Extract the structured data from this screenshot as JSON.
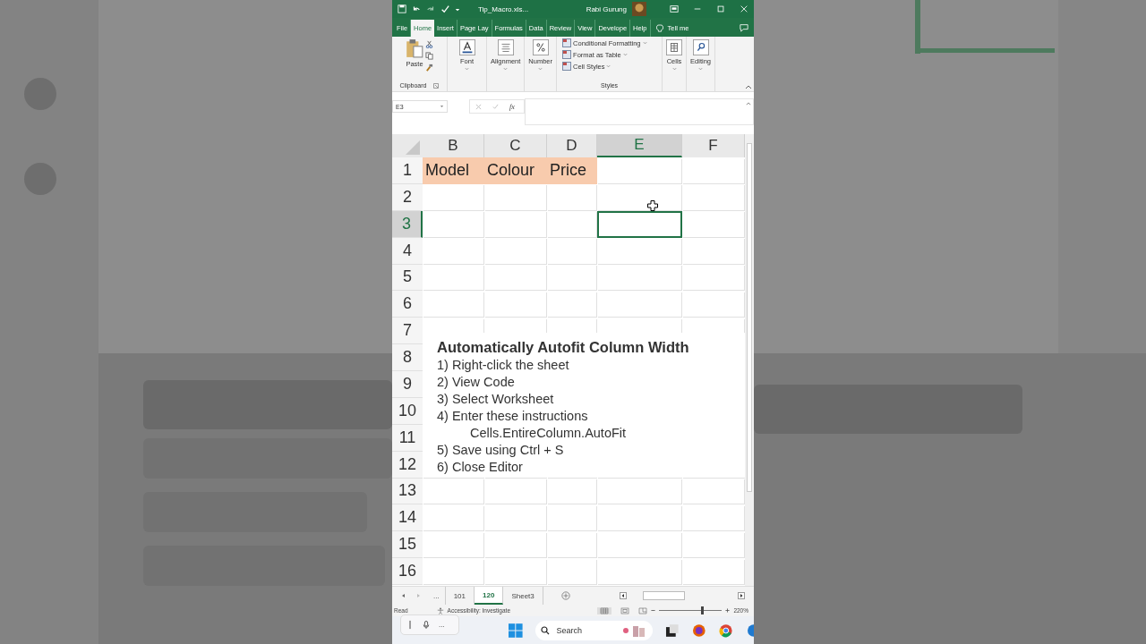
{
  "title_bar": {
    "filename": "Tip_Macro.xls...",
    "user": "Rabi Gurung"
  },
  "ribbon_tabs": [
    {
      "label": "File",
      "selected": false
    },
    {
      "label": "Home",
      "selected": true
    },
    {
      "label": "Insert",
      "selected": false
    },
    {
      "label": "Page Lay",
      "selected": false
    },
    {
      "label": "Formulas",
      "selected": false
    },
    {
      "label": "Data",
      "selected": false
    },
    {
      "label": "Review",
      "selected": false
    },
    {
      "label": "View",
      "selected": false
    },
    {
      "label": "Develope",
      "selected": false
    },
    {
      "label": "Help",
      "selected": false
    }
  ],
  "tell_me": "Tell me",
  "ribbon": {
    "paste": "Paste",
    "clipboard": "Clipboard",
    "groups": [
      {
        "label": "Font",
        "kind": "font"
      },
      {
        "label": "Alignment",
        "kind": "align"
      },
      {
        "label": "Number",
        "kind": "number"
      }
    ],
    "styles": [
      "Conditional Formatting",
      "Format as Table",
      "Cell Styles"
    ],
    "styles_label": "Styles",
    "tools": [
      {
        "label": "Cells",
        "kind": "cells"
      },
      {
        "label": "Editing",
        "kind": "search"
      }
    ]
  },
  "formula_bar": {
    "name_box": "E3",
    "fx": "fx"
  },
  "sheet": {
    "columns": [
      {
        "label": "B",
        "selected": false
      },
      {
        "label": "C",
        "selected": false
      },
      {
        "label": "D",
        "selected": false
      },
      {
        "label": "E",
        "selected": true
      },
      {
        "label": "F",
        "selected": false
      }
    ],
    "header_cells": [
      "Model",
      "Colour",
      "Price"
    ],
    "rows": [
      {
        "label": "1",
        "selected": false
      },
      {
        "label": "2",
        "selected": false
      },
      {
        "label": "3",
        "selected": true
      },
      {
        "label": "4",
        "selected": false
      },
      {
        "label": "5",
        "selected": false
      },
      {
        "label": "6",
        "selected": false
      },
      {
        "label": "7",
        "selected": false
      },
      {
        "label": "8",
        "selected": false
      },
      {
        "label": "9",
        "selected": false
      },
      {
        "label": "10",
        "selected": false
      },
      {
        "label": "11",
        "selected": false
      },
      {
        "label": "12",
        "selected": false
      },
      {
        "label": "13",
        "selected": false
      },
      {
        "label": "14",
        "selected": false
      },
      {
        "label": "15",
        "selected": false
      },
      {
        "label": "16",
        "selected": false
      }
    ]
  },
  "text_box": {
    "title": "Automatically Autofit Column Width",
    "lines": [
      {
        "text": "1) Right-click the sheet",
        "kind": "step"
      },
      {
        "text": "2) View Code",
        "kind": "step"
      },
      {
        "text": "3) Select Worksheet",
        "kind": "step"
      },
      {
        "text": "4) Enter these instructions",
        "kind": "step"
      },
      {
        "text": "Cells.EntireColumn.AutoFit",
        "kind": "code"
      },
      {
        "text": "5) Save using Ctrl + S",
        "kind": "step"
      },
      {
        "text": "6) Close Editor",
        "kind": "step"
      }
    ]
  },
  "sheet_tabs": {
    "more": "...",
    "tabs": [
      {
        "label": "101",
        "selected": false
      },
      {
        "label": "120",
        "selected": true
      },
      {
        "label": "Sheet3",
        "selected": false
      }
    ]
  },
  "status_bar": {
    "status": "Read",
    "accessibility": "Accessibility: Investigate",
    "zoom": "220%",
    "level": 0.68
  },
  "dictation": {
    "more": "..."
  },
  "taskbar": {
    "search": "Search"
  }
}
